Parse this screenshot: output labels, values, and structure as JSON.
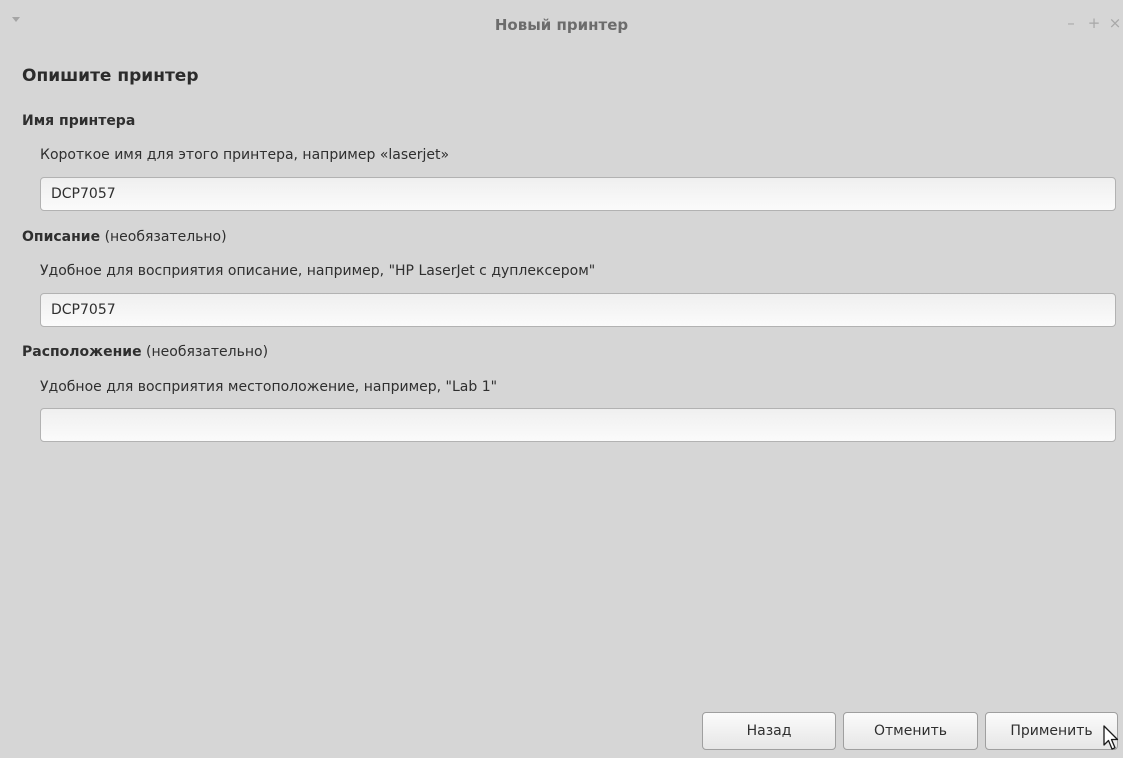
{
  "window": {
    "title": "Новый принтер",
    "controls": {
      "minimize": "–",
      "maximize": "+",
      "close": "×"
    }
  },
  "page": {
    "heading": "Опишите принтер"
  },
  "printer_name": {
    "label": "Имя принтера",
    "hint": "Короткое имя для этого принтера, например «laserjet»",
    "value": "DCP7057"
  },
  "description": {
    "label": "Описание",
    "optional": "(необязательно)",
    "hint": "Удобное для восприятия описание, например, \"HP LaserJet с дуплексером\"",
    "value": "DCP7057"
  },
  "location": {
    "label": "Расположение",
    "optional": "(необязательно)",
    "hint": "Удобное для восприятия местоположение, например, \"Lab 1\"",
    "value": ""
  },
  "buttons": {
    "back": "Назад",
    "cancel": "Отменить",
    "apply": "Применить"
  },
  "icons": {
    "window_menu": "triangle-down-icon",
    "cursor": "mouse-pointer-icon"
  }
}
